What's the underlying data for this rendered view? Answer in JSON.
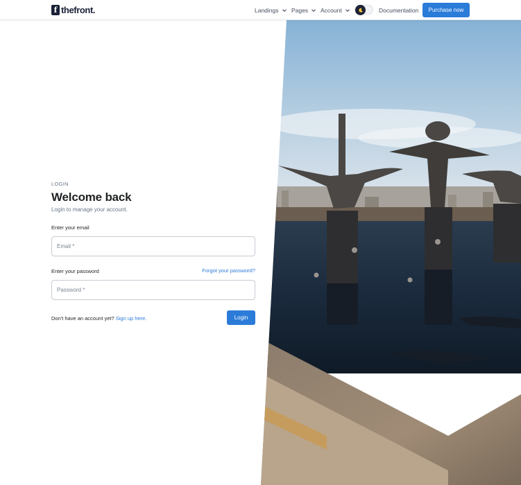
{
  "header": {
    "logo_mark": "f",
    "logo_text": "thefront.",
    "nav": [
      {
        "label": "Landings"
      },
      {
        "label": "Pages"
      },
      {
        "label": "Account"
      }
    ],
    "theme_toggle_icon": "moon-icon",
    "documentation_label": "Documentation",
    "purchase_label": "Purchase now"
  },
  "login": {
    "overline": "LOGIN",
    "title": "Welcome back",
    "subtitle": "Login to manage your account.",
    "email_label": "Enter your email",
    "email_placeholder": "Email *",
    "password_label": "Enter your password",
    "forgot_label": "Forgot your password?",
    "password_placeholder": "Password *",
    "no_account_text": "Don't have an account yet?",
    "signup_label": "Sign up here.",
    "login_label": "Login"
  },
  "colors": {
    "primary": "#2b7bd8",
    "text_dark": "#1e2022",
    "text_muted": "#677788"
  },
  "hero_image": "sculptures-pool-photo"
}
